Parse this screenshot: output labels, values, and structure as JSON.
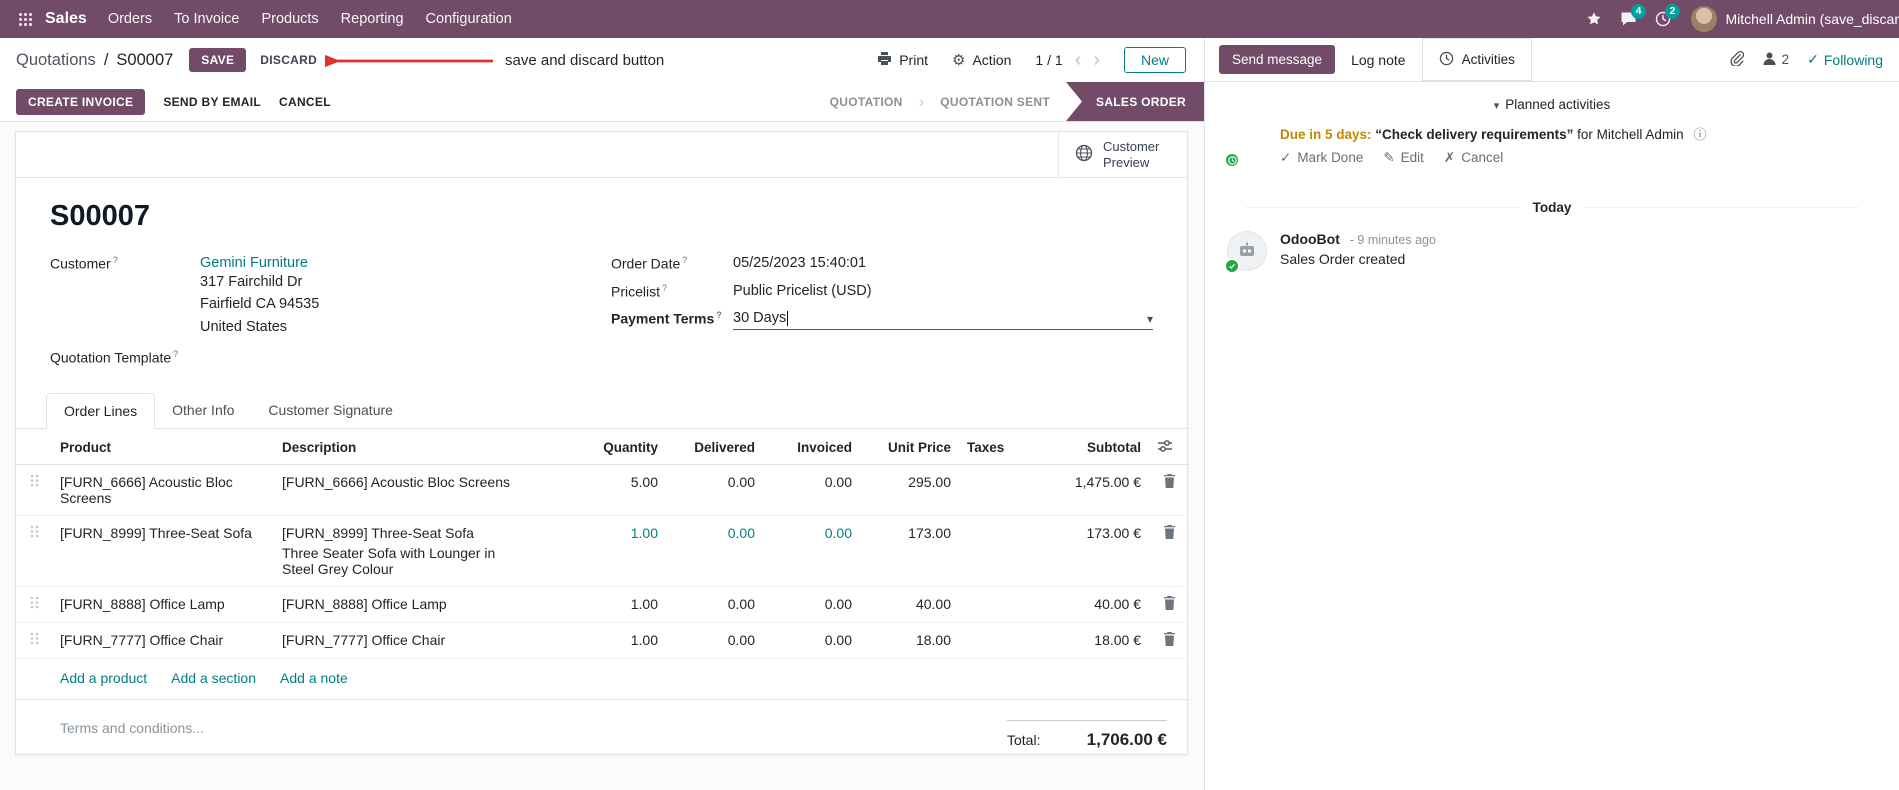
{
  "topbar": {
    "app_name": "Sales",
    "menus": [
      "Orders",
      "To Invoice",
      "Products",
      "Reporting",
      "Configuration"
    ],
    "messages_badge": "4",
    "activities_badge": "2",
    "user_name": "Mitchell Admin (save_discar"
  },
  "breadcrumb": {
    "parent": "Quotations",
    "separator": "/",
    "current": "S00007",
    "save_label": "SAVE",
    "discard_label": "DISCARD"
  },
  "annotation": {
    "text": "save and discard button"
  },
  "controls": {
    "print_label": "Print",
    "action_label": "Action",
    "pager": "1 / 1",
    "new_label": "New"
  },
  "statusbar": {
    "create_invoice": "CREATE INVOICE",
    "send_by_email": "SEND BY EMAIL",
    "cancel": "CANCEL",
    "states": [
      "QUOTATION",
      "QUOTATION SENT",
      "SALES ORDER"
    ],
    "active_state": "SALES ORDER"
  },
  "sheet": {
    "stat_button": "Customer Preview",
    "title": "S00007",
    "hint": "?",
    "fields": {
      "customer_label": "Customer",
      "customer_value": "Gemini Furniture",
      "address": [
        "317 Fairchild Dr",
        "Fairfield CA 94535",
        "United States"
      ],
      "quotation_template_label": "Quotation Template",
      "order_date_label": "Order Date",
      "order_date_value": "05/25/2023 15:40:01",
      "pricelist_label": "Pricelist",
      "pricelist_value": "Public Pricelist (USD)",
      "payment_terms_label": "Payment Terms",
      "payment_terms_value": "30 Days"
    },
    "tabs": [
      "Order Lines",
      "Other Info",
      "Customer Signature"
    ],
    "table": {
      "headers": [
        "Product",
        "Description",
        "Quantity",
        "Delivered",
        "Invoiced",
        "Unit Price",
        "Taxes",
        "Subtotal"
      ],
      "rows": [
        {
          "product": "[FURN_6666] Acoustic Bloc Screens",
          "description": "[FURN_6666] Acoustic Bloc Screens",
          "quantity": "5.00",
          "delivered": "0.00",
          "invoiced": "0.00",
          "unit_price": "295.00",
          "taxes": "",
          "subtotal": "1,475.00 €"
        },
        {
          "product": "[FURN_8999] Three-Seat Sofa",
          "description": "[FURN_8999] Three-Seat Sofa",
          "description2": "Three Seater Sofa with Lounger in Steel Grey Colour",
          "quantity": "1.00",
          "delivered": "0.00",
          "invoiced": "0.00",
          "unit_price": "173.00",
          "taxes": "",
          "subtotal": "173.00 €"
        },
        {
          "product": "[FURN_8888] Office Lamp",
          "description": "[FURN_8888] Office Lamp",
          "quantity": "1.00",
          "delivered": "0.00",
          "invoiced": "0.00",
          "unit_price": "40.00",
          "taxes": "",
          "subtotal": "40.00 €"
        },
        {
          "product": "[FURN_7777] Office Chair",
          "description": "[FURN_7777] Office Chair",
          "quantity": "1.00",
          "delivered": "0.00",
          "invoiced": "0.00",
          "unit_price": "18.00",
          "taxes": "",
          "subtotal": "18.00 €"
        }
      ],
      "add_links": [
        "Add a product",
        "Add a section",
        "Add a note"
      ]
    },
    "terms_placeholder": "Terms and conditions...",
    "total_label": "Total:",
    "total_value": "1,706.00 €"
  },
  "chatter": {
    "send_message": "Send message",
    "log_note": "Log note",
    "activities_tab": "Activities",
    "followers_count": "2",
    "following_label": "Following",
    "planned_activities": "Planned activities",
    "activity": {
      "due": "Due in 5 days:",
      "summary": "“Check delivery requirements”",
      "assignee": "for Mitchell Admin",
      "mark_done": "Mark Done",
      "edit": "Edit",
      "cancel": "Cancel"
    },
    "date_separator": "Today",
    "message": {
      "author": "OdooBot",
      "time": "- 9 minutes ago",
      "body": "Sales Order created"
    }
  },
  "icons": {
    "gear": "⚙",
    "caret_down": "▾",
    "chevron_left": "‹",
    "chevron_right": "›",
    "state_separator": "›",
    "check": "✓",
    "pencil": "✎",
    "x_mark": "✗",
    "info": "ⓘ",
    "collapse_caret": "▾"
  },
  "colors": {
    "primary": "#714B67",
    "link": "#017E84",
    "badge": "#00A09D",
    "annotation_arrow": "#E03131",
    "activity_due": "#BE8A00"
  }
}
